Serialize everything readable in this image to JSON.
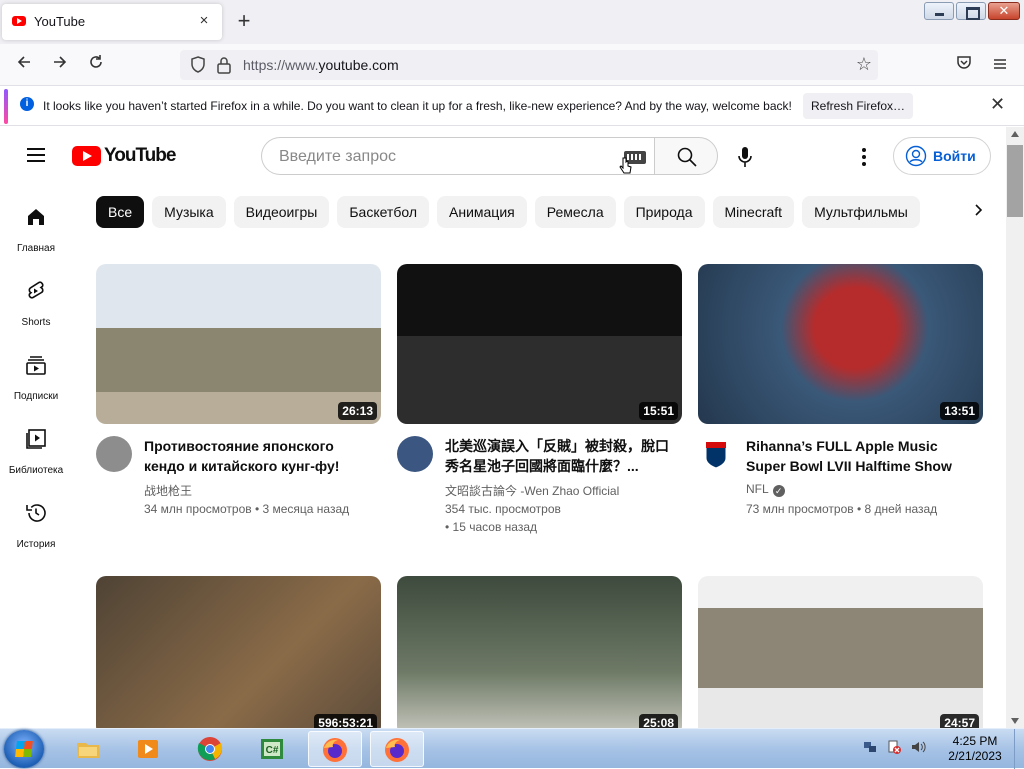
{
  "browser": {
    "tab_title": "YouTube",
    "tab_close": "×",
    "new_tab": "+",
    "url_prefix": "https://www.",
    "url_domain": "youtube.com",
    "notice_text": "It looks like you haven’t started Firefox in a while. Do you want to clean it up for a fresh, like-new experience? And by the way, welcome back!",
    "notice_button": "Refresh Firefox…",
    "notice_close": "✕"
  },
  "youtube": {
    "logo_text": "YouTube",
    "search_placeholder": "Введите запрос",
    "signin_label": "Войти",
    "sidebar": [
      {
        "label": "Главная",
        "icon": "home-icon"
      },
      {
        "label": "Shorts",
        "icon": "shorts-icon"
      },
      {
        "label": "Подписки",
        "icon": "subscriptions-icon"
      },
      {
        "label": "Библиотека",
        "icon": "library-icon"
      },
      {
        "label": "История",
        "icon": "history-icon"
      }
    ],
    "chips": [
      "Все",
      "Музыка",
      "Видеоигры",
      "Баскетбол",
      "Анимация",
      "Ремесла",
      "Природа",
      "Minecraft",
      "Мультфильмы"
    ],
    "videos": [
      {
        "title": "Противостояние японского кендо и китайского кунг-фу!",
        "channel": "战地枪王",
        "stats": "34 млн просмотров • 3 месяца назад",
        "duration": "26:13",
        "verified": false,
        "thumb_color": "#9aa08c",
        "avatar_color": "#7a7a7a"
      },
      {
        "title": "北美巡演誤入「反賊」被封殺，脫口秀名星池子回國將面臨什麼？...",
        "channel": "文昭談古論今 -Wen Zhao Official",
        "stats": "354 тыс. просмотров\n• 15 часов назад",
        "duration": "15:51",
        "verified": false,
        "thumb_color": "#2b2b2b",
        "avatar_color": "#3b5680"
      },
      {
        "title": "Rihanna’s FULL Apple Music Super Bowl LVII Halftime Show",
        "channel": "NFL",
        "stats": "73 млн просмотров • 8 дней назад",
        "duration": "13:51",
        "verified": true,
        "thumb_color": "#33506e",
        "avatar_color": "#013369"
      },
      {
        "title": "",
        "channel": "",
        "stats": "",
        "duration": "596:53:21",
        "verified": false,
        "thumb_color": "#6b5b44",
        "avatar_color": "#ffffff"
      },
      {
        "title": "",
        "channel": "",
        "stats": "",
        "duration": "25:08",
        "verified": false,
        "thumb_color": "#4e5a4c",
        "avatar_color": "#ffffff"
      },
      {
        "title": "",
        "channel": "",
        "stats": "",
        "duration": "24:57",
        "verified": false,
        "thumb_color": "#a99c86",
        "avatar_color": "#ffffff"
      }
    ]
  },
  "taskbar": {
    "time": "4:25 PM",
    "date": "2/21/2023",
    "apps": [
      "file-explorer-icon",
      "media-player-icon",
      "chrome-icon",
      "csharp-icon",
      "firefox-icon",
      "firefox-icon"
    ]
  }
}
